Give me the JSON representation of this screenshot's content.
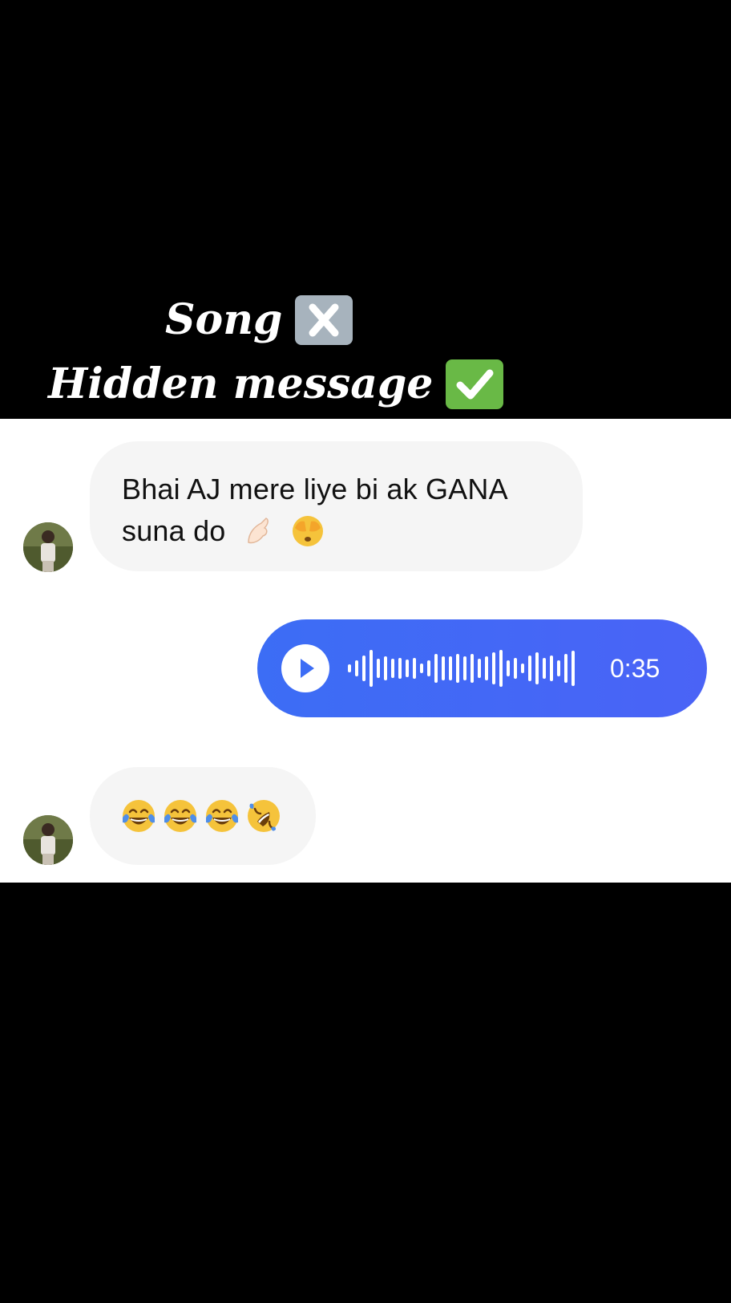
{
  "caption": {
    "line1": "Song",
    "line1_emoji": "cross-mark-icon",
    "line2": "Hidden message",
    "line2_emoji": "check-mark-icon"
  },
  "messages": [
    {
      "direction": "incoming",
      "text": "Bhai AJ mere liye bi ak GANA suna do",
      "emojis": [
        "pinched-fingers-icon",
        "face-with-hands-over-eyes-icon"
      ]
    },
    {
      "direction": "outgoing",
      "type": "voice",
      "duration": "0:35"
    },
    {
      "direction": "incoming",
      "emojis": [
        "tears-of-joy-icon",
        "tears-of-joy-icon",
        "tears-of-joy-icon",
        "rolling-on-floor-laughing-icon"
      ]
    }
  ],
  "colors": {
    "outgoing_bubble": "#3c6df5",
    "incoming_bubble": "#f5f5f5",
    "background": "#000000"
  }
}
